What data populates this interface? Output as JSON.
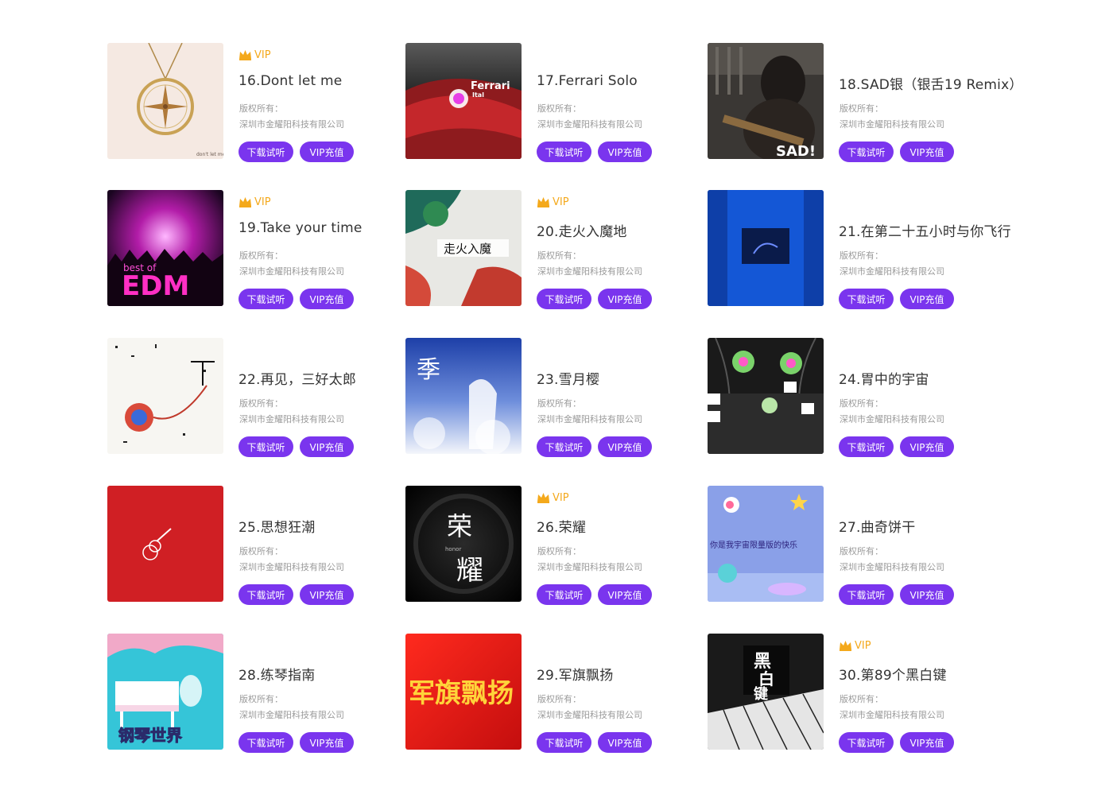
{
  "accent_color": "#7a35ee",
  "vip_color": "#f4a91c",
  "vip_label": "VIP",
  "copyright_label": "版权所有：",
  "copyright_owner": "深圳市金耀阳科技有限公司",
  "buttons": {
    "listen": "下载试听",
    "charge": "VIP充值"
  },
  "songs": [
    {
      "title": "16.Dont let me",
      "vip": true,
      "cover": "dont-let-me-cover",
      "cover_text": "don't let me"
    },
    {
      "title": "17.Ferrari Solo",
      "vip": false,
      "cover": "ferrari-cover",
      "cover_text": "Ferrari"
    },
    {
      "title": "18.SAD银（银舌19 Remix）",
      "vip": false,
      "cover": "sad-cover",
      "cover_text": "SAD!"
    },
    {
      "title": "19.Take your time",
      "vip": true,
      "cover": "edm-cover",
      "cover_text": "EDM"
    },
    {
      "title": "20.走火入魔地",
      "vip": true,
      "cover": "zouhuo-cover",
      "cover_text": "走火入魔"
    },
    {
      "title": "21.在第二十五小时与你飞行",
      "vip": false,
      "cover": "blue-room-cover",
      "cover_text": ""
    },
    {
      "title": "22.再见，三好太郎",
      "vip": false,
      "cover": "sketch-cover",
      "cover_text": ""
    },
    {
      "title": "23.雪月樱",
      "vip": false,
      "cover": "xueyue-cover",
      "cover_text": "季"
    },
    {
      "title": "24.胃中的宇宙",
      "vip": false,
      "cover": "stomach-universe-cover",
      "cover_text": ""
    },
    {
      "title": "25.思想狂潮",
      "vip": false,
      "cover": "red-guitar-cover",
      "cover_text": ""
    },
    {
      "title": "26.荣耀",
      "vip": true,
      "cover": "honor-cover",
      "cover_text": "荣耀"
    },
    {
      "title": "27.曲奇饼干",
      "vip": false,
      "cover": "space-doodle-cover",
      "cover_text": "你是我宇宙限量版的快乐"
    },
    {
      "title": "28.练琴指南",
      "vip": false,
      "cover": "piano-world-cover",
      "cover_text": "钢琴世界"
    },
    {
      "title": "29.军旗飘扬",
      "vip": false,
      "cover": "flag-cover",
      "cover_text": "军旗飘扬"
    },
    {
      "title": "30.第89个黑白键",
      "vip": true,
      "cover": "keys-cover",
      "cover_text": "黑白键"
    }
  ]
}
